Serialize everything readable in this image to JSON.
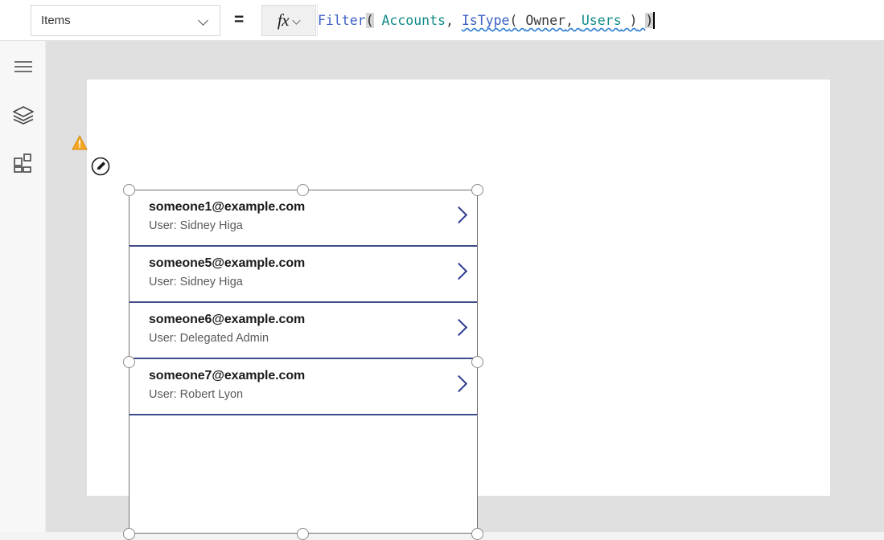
{
  "formula_bar": {
    "property_dropdown": {
      "value": "Items",
      "chevron_icon": "chevron-down-icon"
    },
    "equals": "=",
    "fx_button": {
      "glyph": "fx",
      "chevron_icon": "chevron-down-icon"
    },
    "formula": {
      "full_text": "Filter( Accounts, IsType( Owner, Users ) )",
      "tokens": [
        {
          "text": "Filter",
          "type": "function"
        },
        {
          "text": "(",
          "type": "paren-highlight"
        },
        {
          "text": " Accounts",
          "type": "table"
        },
        {
          "text": ",",
          "type": "punct"
        },
        {
          "text": " ",
          "type": "punct"
        },
        {
          "text": "IsType",
          "type": "function"
        },
        {
          "text": "( ",
          "type": "punct"
        },
        {
          "text": "Owner",
          "type": "field"
        },
        {
          "text": ", ",
          "type": "punct"
        },
        {
          "text": "Users",
          "type": "table"
        },
        {
          "text": " )",
          "type": "punct"
        },
        {
          "text": " ",
          "type": "punct"
        },
        {
          "text": ")",
          "type": "paren-highlight"
        }
      ],
      "has_delegation_squiggle": true
    }
  },
  "left_rail": {
    "items": [
      {
        "name": "menu-icon",
        "label": "Menu"
      },
      {
        "name": "tree-view-icon",
        "label": "Tree view"
      },
      {
        "name": "insert-icon",
        "label": "Insert"
      }
    ]
  },
  "canvas": {
    "gallery": {
      "selected": true,
      "warning_badge": "warning-icon",
      "edit_badge": "edit-pencil-icon",
      "items": [
        {
          "title": "someone1@example.com",
          "subtitle": "User: Sidney Higa",
          "chevron_icon": "chevron-right-icon"
        },
        {
          "title": "someone5@example.com",
          "subtitle": "User: Sidney Higa",
          "chevron_icon": "chevron-right-icon"
        },
        {
          "title": "someone6@example.com",
          "subtitle": "User: Delegated Admin",
          "chevron_icon": "chevron-right-icon"
        },
        {
          "title": "someone7@example.com",
          "subtitle": "User: Robert Lyon",
          "chevron_icon": "chevron-right-icon"
        }
      ]
    }
  },
  "colors": {
    "function_token": "#3c60c4",
    "table_token": "#108b88",
    "field_token": "#3b3b3b",
    "squiggle": "#2f7fd4",
    "chevron": "#2b3a8f",
    "separator": "#3f4a8a",
    "warning": "#f5a623",
    "canvas_background": "#e0e0e0"
  }
}
